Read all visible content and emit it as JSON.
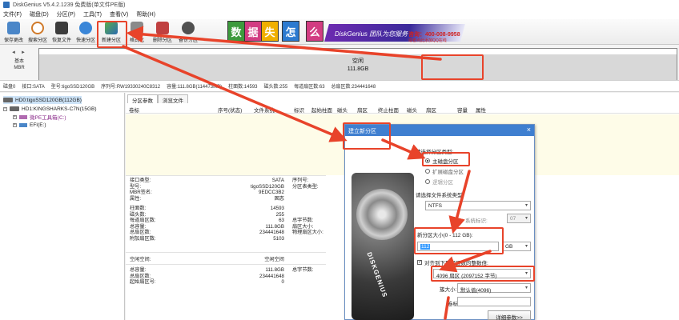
{
  "window": {
    "title": "DiskGenius V5.4.2.1239 免费版(单文件PE版)"
  },
  "menu": [
    "文件(F)",
    "磁盘(D)",
    "分区(P)",
    "工具(T)",
    "查看(V)",
    "帮助(H)"
  ],
  "toolbar": {
    "buttons": [
      {
        "label": "保存更改",
        "icon": "save-icon",
        "color": "#4a86c8"
      },
      {
        "label": "搜索分区",
        "icon": "search-icon",
        "color": "#d7a04a"
      },
      {
        "label": "恢复文件",
        "icon": "recover-icon",
        "color": "#3c3c3c"
      },
      {
        "label": "快速分区",
        "icon": "quick-partition-icon",
        "color": "#3a86d8"
      },
      {
        "label": "新建分区",
        "icon": "new-partition-icon",
        "color": "#4c9a3c"
      },
      {
        "label": "格式化",
        "icon": "format-icon",
        "color": "#8a8a8a"
      },
      {
        "label": "删除分区",
        "icon": "delete-partition-icon",
        "color": "#c04040"
      },
      {
        "label": "备份分区",
        "icon": "backup-icon",
        "color": "#505050"
      }
    ]
  },
  "banner": {
    "chars": [
      "数",
      "据",
      "失",
      "怎",
      "么",
      "办"
    ],
    "char_colors": [
      "#3d9a3d",
      "#d23c82",
      "#f0b000",
      "#2c7ad0",
      "#d23c82",
      "#e07000"
    ],
    "ribbon_text": "DiskGenius 团队为您服务",
    "phone": "咨询：400-008-9958",
    "qq": "或者点此添加QQ在线"
  },
  "disk_strip": {
    "basic_label": "基本",
    "mbr_label": "MBR",
    "partition_label": "空闲",
    "partition_size": "111.8GB"
  },
  "status_line": [
    "磁盘0",
    "接口:SATA",
    "型号:tigoSSD120GB",
    "序列号:RW19330240C8312",
    "容量:111.8GB(114473MB)",
    "柱面数:14593",
    "磁头数:255",
    "每道扇区数:63",
    "总扇区数:234441648"
  ],
  "tree": {
    "items": [
      {
        "label": "HD0:tigoSSD120GB(112GB)",
        "level": 0
      },
      {
        "label": "HD1:KINGSHARKS-C7N(15GB)",
        "level": 0
      },
      {
        "label": "微PE工具箱(C:)",
        "level": 1
      },
      {
        "label": "EFI(E:)",
        "level": 1
      }
    ]
  },
  "tabs": [
    "分区参数",
    "浏览文件"
  ],
  "grid_headers": [
    "卷标",
    "序号(状态)",
    "文件系统",
    "标识",
    "起始柱面",
    "磁头",
    "扇区",
    "终止柱面",
    "磁头",
    "扇区",
    "容量",
    "属性"
  ],
  "disk_info": {
    "left": [
      {
        "k": "接口类型:",
        "v": "SATA"
      },
      {
        "k": "型号:",
        "v": "tigoSSD120GB"
      },
      {
        "k": "MBR签名:",
        "v": "9EDCC3B2"
      },
      {
        "k": "属性:",
        "v": "固态"
      },
      {
        "k": "柱面数:",
        "v": "14593"
      },
      {
        "k": "磁头数:",
        "v": "255"
      },
      {
        "k": "每道扇区数:",
        "v": "63"
      },
      {
        "k": "总容量:",
        "v": "111.8GB"
      },
      {
        "k": "总扇区数:",
        "v": "234441648"
      },
      {
        "k": "附加扇区数:",
        "v": "5103"
      }
    ],
    "right": [
      "序列号:",
      "分区表类型:",
      "总字节数:",
      "扇区大小:",
      "物理扇区大小:"
    ],
    "free_title_k": "空闲空间:",
    "free_title_v": "空闲空间",
    "free": [
      {
        "k": "总容量:",
        "v": "111.8GB"
      },
      {
        "k": "总扇区数:",
        "v": "234441648"
      },
      {
        "k": "起始扇区号:",
        "v": "0"
      }
    ],
    "free_right": [
      "总字节数:"
    ]
  },
  "dialog": {
    "title": "建立新分区",
    "close": "×",
    "type_prompt": "请选择分区类型:",
    "types": [
      {
        "label": "主磁盘分区",
        "checked": true
      },
      {
        "label": "扩展磁盘分区",
        "checked": false
      },
      {
        "label": "逻辑分区",
        "checked": false
      }
    ],
    "fs_prompt": "请选择文件系统类型:",
    "fs_value": "NTFS",
    "sysid_label": "系统标识:",
    "sysid_value": "07",
    "size_prompt": "新分区大小(0 - 112 GB):",
    "size_value": "112",
    "size_unit": "GB",
    "align_label": "对齐到下列扇区数的整数倍:",
    "align_checked": true,
    "align_value": "4096 扇区 (2097152 字节)",
    "cluster_label": "簇大小:",
    "cluster_value": "默认值(4096)",
    "volume_label": "卷标:",
    "detail_button": "详细参数>>",
    "image_brand": "DISKGENIUS"
  }
}
